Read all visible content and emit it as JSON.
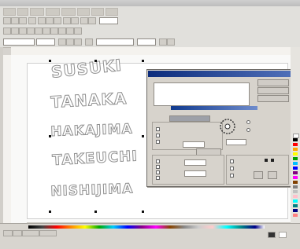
{
  "canvas": {
    "words": [
      "SUSUKI",
      "TANAKA",
      "HAKAJIMA",
      "TAKEUCHI",
      "NISHIJIMA"
    ]
  },
  "palette": {
    "colors": [
      "#ffffff",
      "#000000",
      "#ff0000",
      "#ffa500",
      "#ffff00",
      "#00a000",
      "#00c0ff",
      "#0000ff",
      "#800080",
      "#ff00ff",
      "#804000",
      "#808080",
      "#c0c0c0",
      "#ffc0cb",
      "#00ffff",
      "#008080",
      "#000080",
      "#ff8080",
      "#80ff80",
      "#8080ff"
    ]
  },
  "colors": {
    "dialog_title": "#0c2c7c",
    "dialog_bg": "#d7d3cc",
    "chrome": "#e1e0dc",
    "text_outline": "#8f8f8f"
  }
}
